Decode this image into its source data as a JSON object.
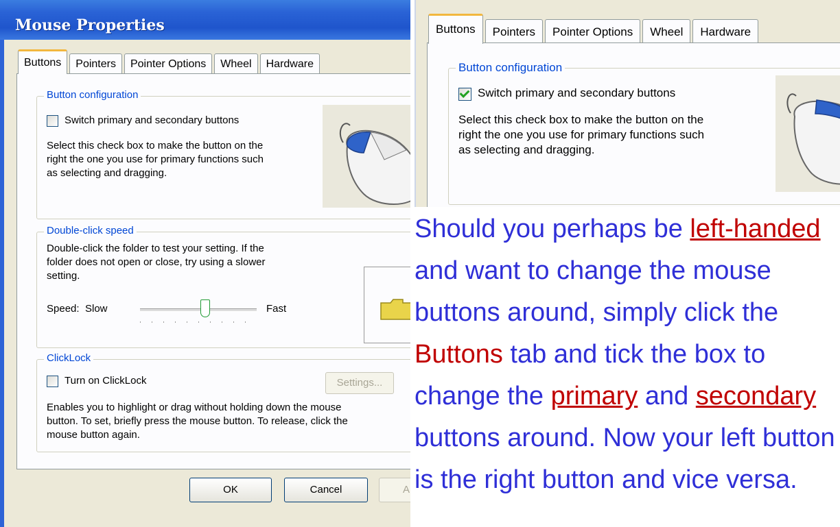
{
  "window": {
    "title": "Mouse Properties",
    "tabs": [
      "Buttons",
      "Pointers",
      "Pointer Options",
      "Wheel",
      "Hardware"
    ],
    "active_tab": "Buttons"
  },
  "button_config": {
    "legend": "Button configuration",
    "checkbox_label": "Switch primary and secondary buttons",
    "description_lines": [
      "Select this check box to make the button on the",
      "right the one you use for primary functions such",
      "as selecting and dragging."
    ]
  },
  "double_click": {
    "legend": "Double-click speed",
    "description_lines": [
      "Double-click the folder to test your setting. If the",
      "folder does not open or close, try using a slower",
      "setting."
    ],
    "speed_label": "Speed:",
    "slow_label": "Slow",
    "fast_label": "Fast"
  },
  "clicklock": {
    "legend": "ClickLock",
    "checkbox_label": "Turn on ClickLock",
    "settings_button": "Settings...",
    "description_lines": [
      "Enables you to highlight or drag without holding down the mouse",
      "button. To set, briefly press the mouse button. To release, click the",
      "mouse button again."
    ]
  },
  "footer": {
    "ok": "OK",
    "cancel": "Cancel",
    "apply_partial": "A"
  },
  "right_crop": {
    "tabs": [
      "Buttons",
      "Pointers",
      "Pointer Options",
      "Wheel",
      "Hardware"
    ],
    "legend": "Button configuration",
    "checkbox_label": "Switch primary and secondary buttons",
    "checkbox_checked": true,
    "description_lines": [
      "Select this check box to make the button on the",
      "right the one you use for primary functions such",
      "as selecting and dragging."
    ]
  },
  "prose": {
    "part1": "Should you perhaps be ",
    "link1": "left-handed",
    "part2": " and want to change the mouse buttons around, simply click the ",
    "highlight": "Buttons",
    "part3": " tab and tick the box to change the ",
    "link2": "primary",
    "part4": " and ",
    "link3": "secondary",
    "part5": " buttons around. Now your left button is the right button and vice versa."
  },
  "colors": {
    "title_bar": "#2a63d6",
    "legend_text": "#0046d5",
    "prose_text": "#2f2fd7",
    "prose_highlight": "#c00000",
    "active_tab_accent": "#f2b73e"
  }
}
